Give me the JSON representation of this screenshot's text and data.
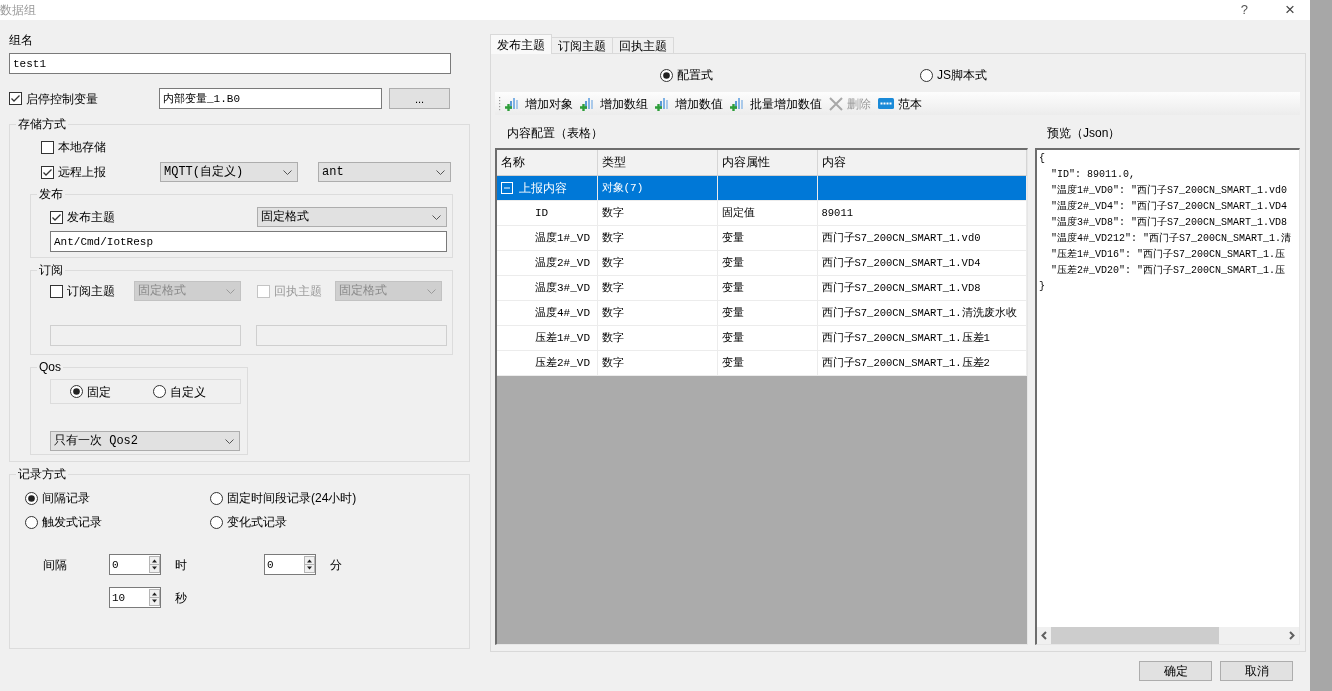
{
  "window": {
    "title": "数据组",
    "help_button": "?",
    "close_button": "×"
  },
  "group_name": {
    "label": "组名",
    "value": "test1"
  },
  "control_variable": {
    "label": "启停控制变量",
    "checked": true,
    "value": "内部变量_1.B0",
    "browse_button": "..."
  },
  "storage": {
    "title": "存储方式",
    "local": {
      "label": "本地存储",
      "checked": false
    },
    "remote": {
      "label": "远程上报",
      "checked": true,
      "protocol": "MQTT(自定义)",
      "server": "ant"
    },
    "publish": {
      "title": "发布",
      "label": "发布主题",
      "checked": true,
      "format": "固定格式",
      "topic": "Ant/Cmd/IotResp"
    },
    "subscribe": {
      "title": "订阅",
      "items": [
        {
          "label": "订阅主题",
          "checked": false,
          "disabled": false,
          "format": "固定格式",
          "format_disabled": true,
          "topic_disabled": true
        },
        {
          "label": "回执主题",
          "checked": false,
          "disabled": true,
          "format": "固定格式",
          "format_disabled": true,
          "topic_disabled": true
        }
      ]
    },
    "qos": {
      "title": "Qos",
      "options": [
        {
          "label": "固定",
          "selected": true
        },
        {
          "label": "自定义",
          "selected": false
        }
      ],
      "value": "只有一次 Qos2"
    }
  },
  "recording": {
    "title": "记录方式",
    "options": [
      {
        "label": "间隔记录",
        "selected": true
      },
      {
        "label": "固定时间段记录(24小时)",
        "selected": false
      },
      {
        "label": "触发式记录",
        "selected": false
      },
      {
        "label": "变化式记录",
        "selected": false
      }
    ],
    "interval_label": "间隔",
    "spinners": [
      {
        "value": "0",
        "unit": "时"
      },
      {
        "value": "0",
        "unit": "分"
      },
      {
        "value": "10",
        "unit": "秒"
      }
    ]
  },
  "tabs": [
    {
      "label": "发布主题",
      "selected": true
    },
    {
      "label": "订阅主题",
      "selected": false
    },
    {
      "label": "回执主题",
      "selected": false
    }
  ],
  "mode_options": [
    {
      "label": "配置式",
      "selected": true
    },
    {
      "label": "JS脚本式",
      "selected": false
    }
  ],
  "toolbar": [
    {
      "label": "增加对象",
      "kind": "add",
      "disabled": false
    },
    {
      "label": "增加数组",
      "kind": "add",
      "disabled": false
    },
    {
      "label": "增加数值",
      "kind": "add",
      "disabled": false
    },
    {
      "label": "批量增加数值",
      "kind": "add",
      "disabled": false
    },
    {
      "label": "删除",
      "kind": "delete",
      "disabled": true
    },
    {
      "label": "范本",
      "kind": "template",
      "disabled": false
    }
  ],
  "table": {
    "title": "内容配置（表格）",
    "columns": [
      "名称",
      "类型",
      "内容属性",
      "内容"
    ],
    "rows": [
      {
        "name": "上报内容",
        "type": "对象(7)",
        "selected": true,
        "expanded": true,
        "children": [
          {
            "name": "ID",
            "type": "数字",
            "property": "固定值",
            "content": "89011",
            "selected": false
          },
          {
            "name": "温度1#_VD",
            "type": "数字",
            "property": "变量",
            "content": "西门子S7_200CN_SMART_1.vd0",
            "selected": false
          },
          {
            "name": "温度2#_VD",
            "type": "数字",
            "property": "变量",
            "content": "西门子S7_200CN_SMART_1.VD4",
            "selected": false
          },
          {
            "name": "温度3#_VD",
            "type": "数字",
            "property": "变量",
            "content": "西门子S7_200CN_SMART_1.VD8",
            "selected": false
          },
          {
            "name": "温度4#_VD",
            "type": "数字",
            "property": "变量",
            "content": "西门子S7_200CN_SMART_1.清洗废水收",
            "selected": false
          },
          {
            "name": "压差1#_VD",
            "type": "数字",
            "property": "变量",
            "content": "西门子S7_200CN_SMART_1.压差1",
            "selected": false
          },
          {
            "name": "压差2#_VD",
            "type": "数字",
            "property": "变量",
            "content": "西门子S7_200CN_SMART_1.压差2",
            "selected": false
          }
        ]
      }
    ]
  },
  "preview": {
    "title": "预览（Json）",
    "lines": [
      "{",
      "  \"ID\": 89011.0,",
      "  \"温度1#_VD0\": \"西门子S7_200CN_SMART_1.vd0",
      "  \"温度2#_VD4\": \"西门子S7_200CN_SMART_1.VD4",
      "  \"温度3#_VD8\": \"西门子S7_200CN_SMART_1.VD8",
      "  \"温度4#_VD212\": \"西门子S7_200CN_SMART_1.清",
      "  \"压差1#_VD16\": \"西门子S7_200CN_SMART_1.压",
      "  \"压差2#_VD20\": \"西门子S7_200CN_SMART_1.压",
      "}"
    ]
  },
  "buttons": [
    "确定",
    "取消"
  ]
}
